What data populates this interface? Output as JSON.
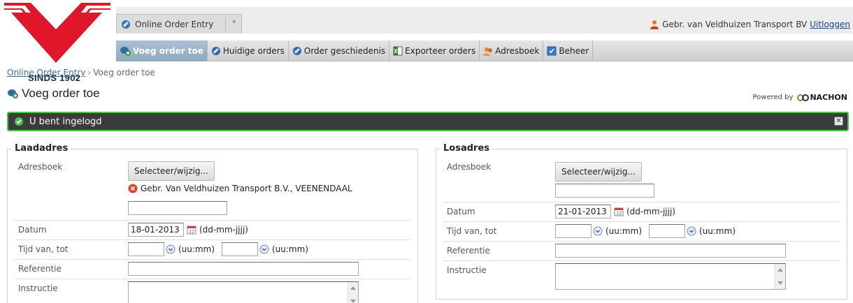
{
  "logo": {
    "text": "SINDS 1902"
  },
  "app_switcher": {
    "label": "Online Order Entry"
  },
  "user": {
    "name": "Gebr. van Veldhuizen Transport BV",
    "logout": "Uitloggen"
  },
  "nav": {
    "items": [
      {
        "label": "Voeg order toe",
        "icon": "add-order-icon",
        "active": true
      },
      {
        "label": "Huidige orders",
        "icon": "orders-icon",
        "active": false
      },
      {
        "label": "Order geschiedenis",
        "icon": "history-icon",
        "active": false
      },
      {
        "label": "Exporteer orders",
        "icon": "excel-icon",
        "active": false
      },
      {
        "label": "Adresboek",
        "icon": "addressbook-icon",
        "active": false
      },
      {
        "label": "Beheer",
        "icon": "settings-icon",
        "active": false
      }
    ]
  },
  "breadcrumb": {
    "root": "Online Order Entry",
    "separator": "›",
    "current": "Voeg order toe"
  },
  "page": {
    "title": "Voeg order toe",
    "powered_by": "Powered by",
    "brand": "NACHON"
  },
  "alert": {
    "message": "U bent ingelogd",
    "color": "#4ec04e"
  },
  "laadadres": {
    "legend": "Laadadres",
    "adresboek_label": "Adresboek",
    "select_button": "Selecteer/wijzig...",
    "address": "Gebr. Van Veldhuizen Transport B.V., VEENENDAAL",
    "extra_value": "",
    "datum_label": "Datum",
    "datum_value": "18-01-2013",
    "datum_hint": "(dd-mm-jjjj)",
    "tijd_label": "Tijd van, tot",
    "tijd_van": "",
    "tijd_tot": "",
    "tijd_hint": "(uu:mm)",
    "referentie_label": "Referentie",
    "referentie_value": "",
    "instructie_label": "Instructie"
  },
  "losadres": {
    "legend": "Losadres",
    "adresboek_label": "Adresboek",
    "select_button": "Selecteer/wijzig...",
    "extra_value": "",
    "datum_label": "Datum",
    "datum_value": "21-01-2013",
    "datum_hint": "(dd-mm-jjjj)",
    "tijd_label": "Tijd van, tot",
    "tijd_van": "",
    "tijd_tot": "",
    "tijd_hint": "(uu:mm)",
    "referentie_label": "Referentie",
    "referentie_value": "",
    "instructie_label": "Instructie"
  },
  "colors": {
    "brand_red": "#e0162b",
    "nav_active": "#9db6cb",
    "link": "#1a3e8e"
  }
}
